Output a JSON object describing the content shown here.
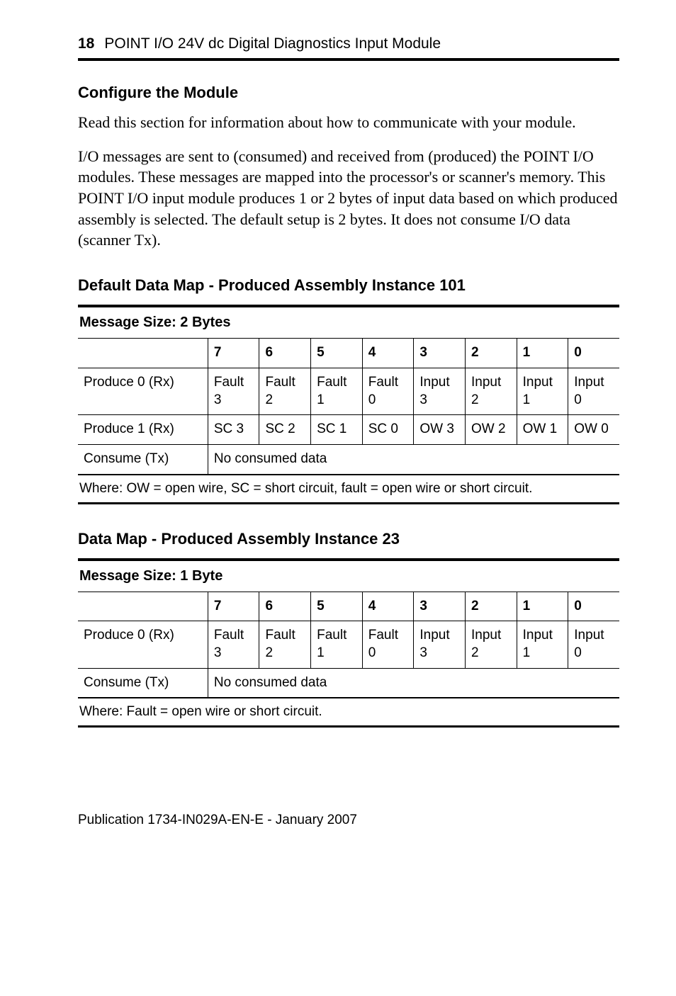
{
  "header": {
    "page_number": "18",
    "title": "POINT I/O 24V dc Digital Diagnostics Input Module"
  },
  "section1": {
    "title": "Configure the Module",
    "para1": "Read this section for information about how to communicate with your module.",
    "para2": "I/O messages are sent to (consumed) and received from (produced) the POINT I/O modules. These messages are mapped into the processor's or scanner's memory. This POINT I/O input module produces 1 or 2 bytes of input data based on which produced assembly is selected. The default setup is 2 bytes. It does not consume I/O data (scanner Tx)."
  },
  "table1": {
    "title": "Default Data Map  - Produced Assembly Instance 101",
    "msg_size": "Message Size: 2 Bytes",
    "cols": [
      "7",
      "6",
      "5",
      "4",
      "3",
      "2",
      "1",
      "0"
    ],
    "rows": [
      {
        "label": "Produce 0  (Rx)",
        "cells": [
          "Fault 3",
          "Fault 2",
          "Fault 1",
          "Fault 0",
          "Input 3",
          "Input 2",
          "Input 1",
          "Input 0"
        ]
      },
      {
        "label": "Produce 1 (Rx)",
        "cells": [
          "SC 3",
          "SC 2",
          "SC 1",
          "SC 0",
          "OW 3",
          "OW 2",
          "OW 1",
          "OW 0"
        ]
      }
    ],
    "consume_label": "Consume (Tx)",
    "consume_value": "No consumed data",
    "footer": "Where: OW = open wire, SC = short circuit, fault = open wire or short circuit."
  },
  "table2": {
    "title": "Data Map - Produced Assembly Instance 23",
    "msg_size": "Message Size: 1 Byte",
    "cols": [
      "7",
      "6",
      "5",
      "4",
      "3",
      "2",
      "1",
      "0"
    ],
    "row": {
      "label": "Produce 0 (Rx)",
      "cells": [
        "Fault 3",
        "Fault 2",
        "Fault 1",
        "Fault 0",
        "Input 3",
        "Input 2",
        "Input 1",
        "Input 0"
      ]
    },
    "consume_label": "Consume (Tx)",
    "consume_value": "No consumed data",
    "footer": "Where: Fault = open wire or short circuit."
  },
  "publication": "Publication 1734-IN029A-EN-E - January 2007"
}
